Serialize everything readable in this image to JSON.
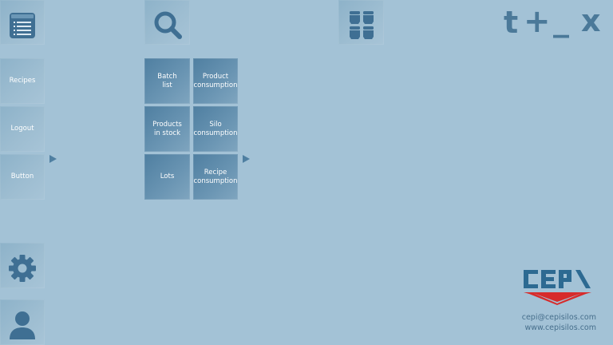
{
  "toolbar": {
    "menu_icon": "list-icon",
    "search_icon": "search-icon",
    "silos_icon": "silos-icon"
  },
  "window_controls": {
    "t_label": "t",
    "plus_label": "+",
    "minimize_label": "_",
    "close_label": "x"
  },
  "sidebar": {
    "items": [
      {
        "label": "Recipes"
      },
      {
        "label": "Logout"
      },
      {
        "label": "Button"
      }
    ],
    "settings_icon": "gear-icon",
    "user_icon": "user-icon"
  },
  "grid": {
    "items": [
      {
        "label": "Batch\nlist"
      },
      {
        "label": "Product\nconsumption"
      },
      {
        "label": "Products\nin stock"
      },
      {
        "label": "Silo\nconsumption"
      },
      {
        "label": "Lots"
      },
      {
        "label": "Recipe\nconsumption"
      }
    ]
  },
  "brand": {
    "logo_text": "CEPI",
    "email": "cepi@cepisilos.com",
    "website": "www.cepisilos.com"
  },
  "colors": {
    "background": "#a3c2d6",
    "tile_dark": "#5e8aab",
    "tile_light": "#9dbdd1",
    "icon": "#3f6f93",
    "logo_blue": "#2d6a92",
    "logo_red": "#d72b2b"
  }
}
